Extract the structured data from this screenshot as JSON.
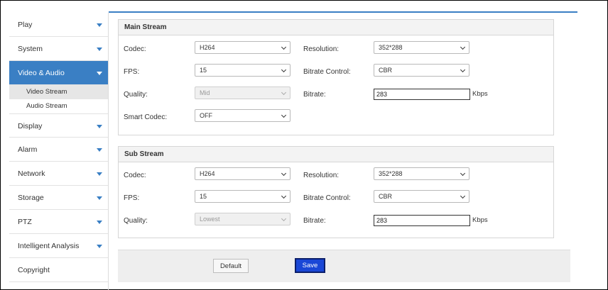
{
  "sidebar": {
    "items": [
      {
        "label": "Play"
      },
      {
        "label": "System"
      },
      {
        "label": "Video & Audio"
      },
      {
        "label": "Display"
      },
      {
        "label": "Alarm"
      },
      {
        "label": "Network"
      },
      {
        "label": "Storage"
      },
      {
        "label": "PTZ"
      },
      {
        "label": "Intelligent Analysis"
      },
      {
        "label": "Copyright"
      }
    ],
    "subitems": [
      {
        "label": "Video Stream"
      },
      {
        "label": "Audio Stream"
      }
    ]
  },
  "main_stream": {
    "title": "Main Stream",
    "codec_label": "Codec:",
    "codec_value": "H264",
    "fps_label": "FPS:",
    "fps_value": "15",
    "quality_label": "Quality:",
    "quality_value": "Mid",
    "smart_codec_label": "Smart Codec:",
    "smart_codec_value": "OFF",
    "resolution_label": "Resolution:",
    "resolution_value": "352*288",
    "bitrate_control_label": "Bitrate Control:",
    "bitrate_control_value": "CBR",
    "bitrate_label": "Bitrate:",
    "bitrate_value": "283",
    "bitrate_unit": "Kbps"
  },
  "sub_stream": {
    "title": "Sub Stream",
    "codec_label": "Codec:",
    "codec_value": "H264",
    "fps_label": "FPS:",
    "fps_value": "15",
    "quality_label": "Quality:",
    "quality_value": "Lowest",
    "resolution_label": "Resolution:",
    "resolution_value": "352*288",
    "bitrate_control_label": "Bitrate Control:",
    "bitrate_control_value": "CBR",
    "bitrate_label": "Bitrate:",
    "bitrate_value": "283",
    "bitrate_unit": "Kbps"
  },
  "footer": {
    "default_label": "Default",
    "save_label": "Save"
  },
  "colors": {
    "accent": "#3a7fc4",
    "save_button": "#1a47d6"
  }
}
